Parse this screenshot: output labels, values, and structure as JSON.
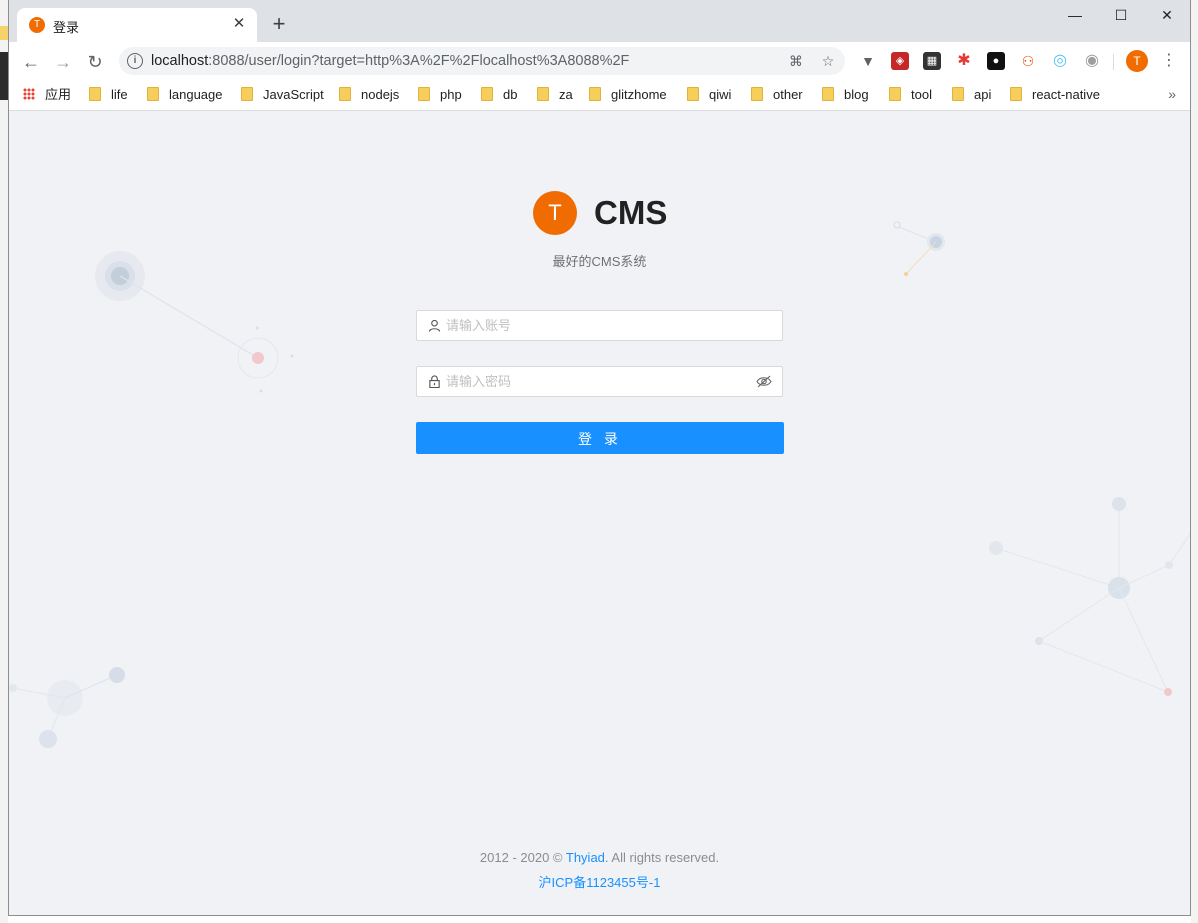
{
  "browser": {
    "tab": {
      "title": "登录",
      "favicon_letter": "T"
    },
    "url": {
      "host": "localhost",
      "rest": ":8088/user/login?target=http%3A%2F%2Flocalhost%3A8088%2F"
    },
    "profile_letter": "T"
  },
  "bookmarks": {
    "apps_label": "应用",
    "items": [
      "life",
      "language",
      "JavaScript",
      "nodejs",
      "php",
      "db",
      "za",
      "glitzhome",
      "qiwi",
      "other",
      "blog",
      "tool",
      "api",
      "react-native"
    ]
  },
  "login": {
    "logo_letter": "T",
    "app_name": "CMS",
    "subtitle": "最好的CMS系统",
    "username_placeholder": "请输入账号",
    "password_placeholder": "请输入密码",
    "submit_label": "登 录"
  },
  "footer": {
    "years": "2012 - 2020 ©",
    "company": "Thyiad",
    "rights": ". All rights reserved.",
    "icp": "沪ICP备1123455号-1"
  },
  "colors": {
    "accent": "#1890ff",
    "brand_orange": "#f06b00",
    "page_bg": "#f0f2f5"
  }
}
